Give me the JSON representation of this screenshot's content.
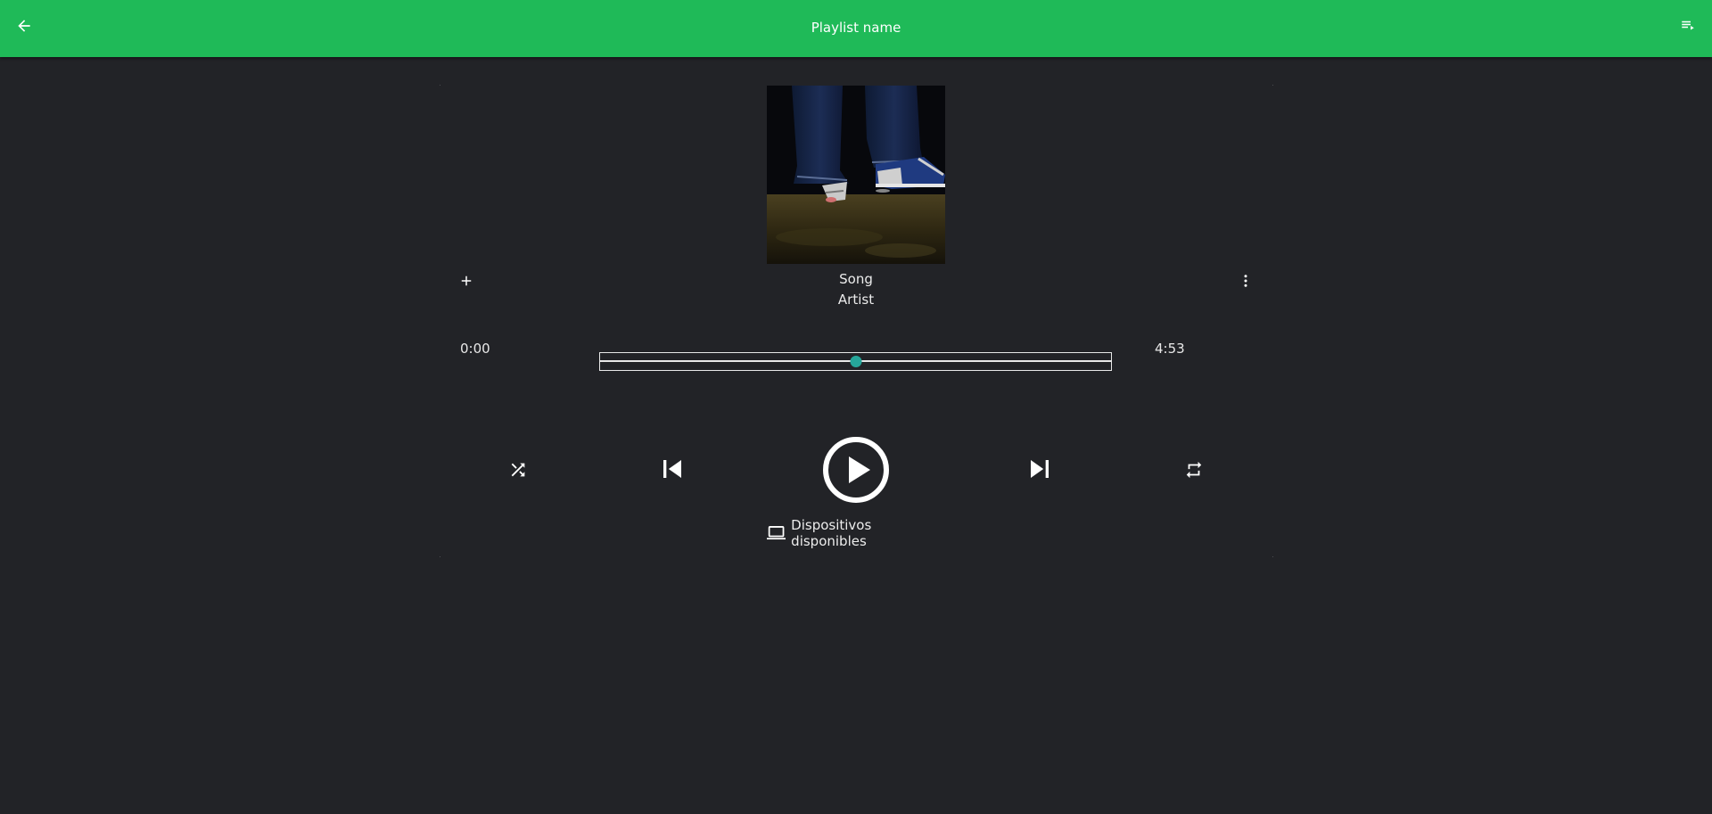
{
  "header": {
    "title": "Playlist name",
    "back_icon": "arrow-back-icon",
    "queue_icon": "queue-music-icon",
    "bar_color": "#1fba58"
  },
  "track": {
    "song": "Song",
    "artist": "Artist",
    "album_art_description_icon": "album-art"
  },
  "progress": {
    "current_time": "0:00",
    "total_time": "4:53",
    "fraction": 0.5,
    "thumb_color": "#26a69a"
  },
  "controls": {
    "add_icon": "add-icon",
    "more_icon": "more-vert-icon",
    "shuffle_icon": "shuffle-icon",
    "previous_icon": "skip-previous-icon",
    "play_icon": "play-circle-icon",
    "next_icon": "skip-next-icon",
    "repeat_icon": "repeat-icon"
  },
  "devices": {
    "label": "Dispositivos disponibles",
    "icon": "laptop-icon"
  },
  "colors": {
    "background": "#222327",
    "text": "#e8e8e8"
  }
}
